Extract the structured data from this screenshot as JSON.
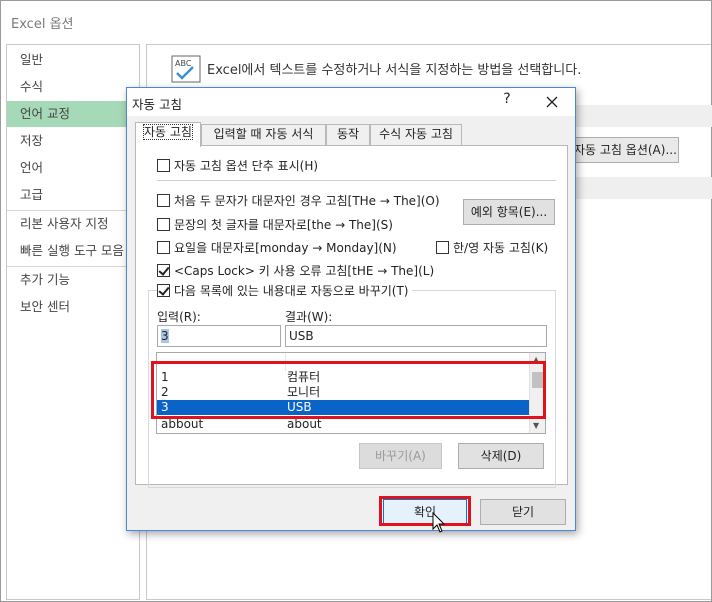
{
  "window": {
    "title": "Excel 옵션"
  },
  "sidebar": {
    "items": [
      {
        "label": "일반"
      },
      {
        "label": "수식"
      },
      {
        "label": "언어 교정"
      },
      {
        "label": "저장"
      },
      {
        "label": "언어"
      },
      {
        "label": "고급"
      },
      {
        "label": "리본 사용자 지정"
      },
      {
        "label": "빠른 실행 도구 모음"
      },
      {
        "label": "추가 기능"
      },
      {
        "label": "보안 센터"
      }
    ],
    "active": "언어 교정"
  },
  "content": {
    "description": "Excel에서 텍스트를 수정하거나 서식을 지정하는 방법을 선택합니다.",
    "icon": "abc-check-icon",
    "autocorrect_options_button": "자동 고침 옵션(A)..."
  },
  "dialog": {
    "title": "자동 고침",
    "help": "?",
    "tabs": [
      "자동 고침",
      "입력할 때 자동 서식",
      "동작",
      "수식 자동 고침"
    ],
    "active_tab": "자동 고침",
    "options": {
      "show_buttons": {
        "label": "자동 고침 옵션 단추 표시(H)",
        "checked": false
      },
      "two_initial_caps": {
        "label": "처음 두 문자가 대문자인 경우 고침[THe → The](O)",
        "checked": false
      },
      "capitalize_sentences": {
        "label": "문장의 첫 글자를 대문자로[the → The](S)",
        "checked": false
      },
      "capitalize_days": {
        "label": "요일을 대문자로[monday → Monday](N)",
        "checked": false
      },
      "caps_lock": {
        "label": "<Caps Lock> 키 사용 오류 고침[tHE → The](L)",
        "checked": true
      },
      "replace_text": {
        "label": "다음 목록에 있는 내용대로 자동으로 바꾸기(T)",
        "checked": true
      },
      "korean_english": {
        "label": "한/영 자동 고침(K)",
        "checked": false
      }
    },
    "exceptions_button": "예외 항목(E)...",
    "input_label": "입력(R):",
    "result_label": "결과(W):",
    "input_value": "3",
    "result_value": "USB",
    "list": [
      {
        "input": "1",
        "result": "컴퓨터"
      },
      {
        "input": "2",
        "result": "모니터"
      },
      {
        "input": "3",
        "result": "USB",
        "selected": true
      },
      {
        "input": "abbout",
        "result": "about"
      }
    ],
    "replace_button": "바꾸기(A)",
    "delete_button": "삭제(D)",
    "ok_button": "확인",
    "close_button": "닫기"
  },
  "colors": {
    "highlight_red": "#e0131c",
    "sidebar_active": "#a6d9b8",
    "list_selection": "#0a64c8",
    "dialog_border": "#4a87d4"
  }
}
